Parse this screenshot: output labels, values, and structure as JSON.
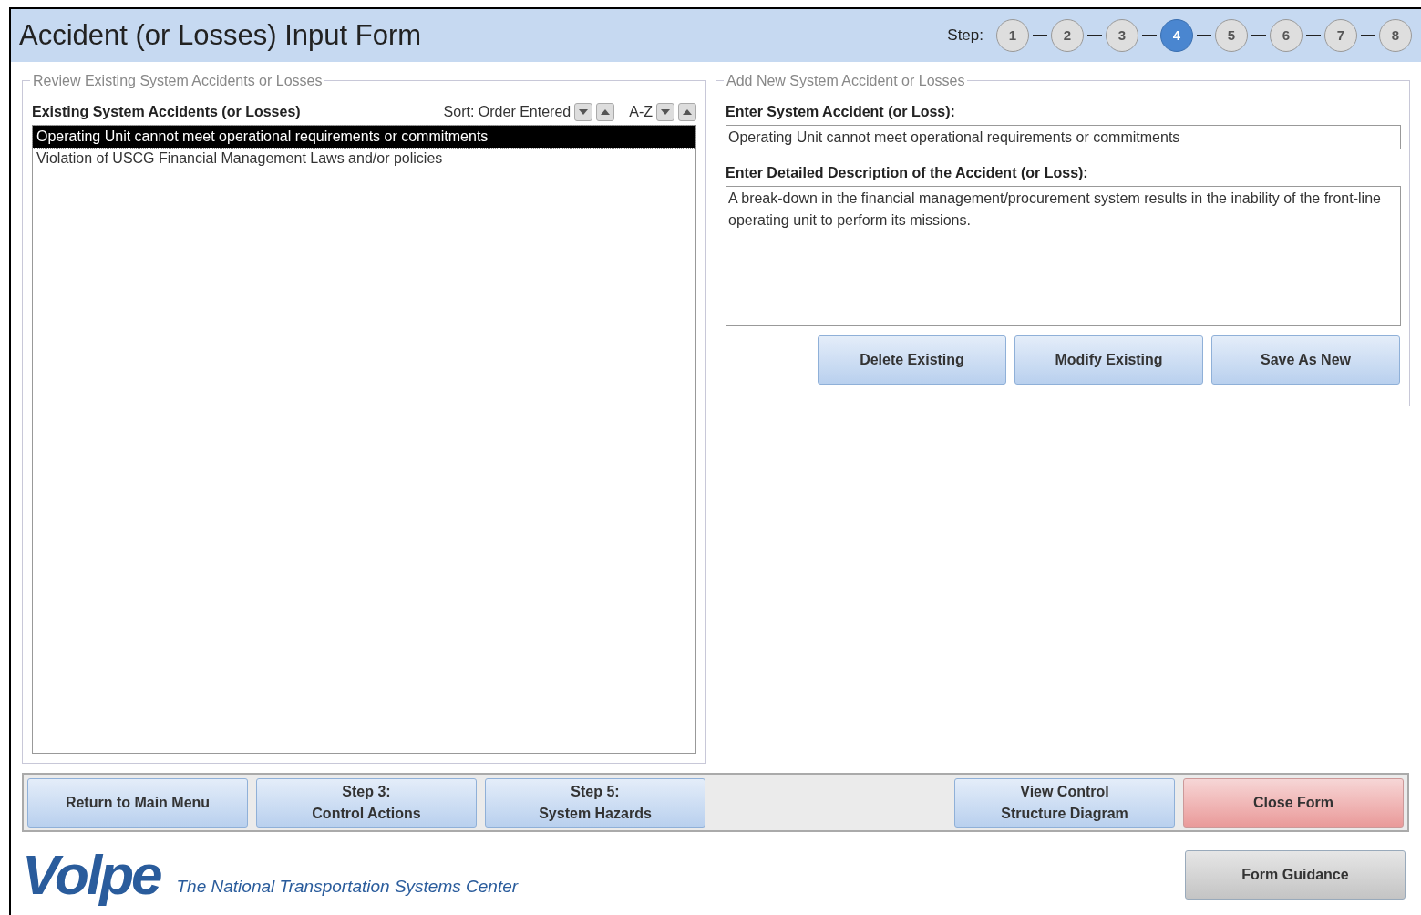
{
  "window": {
    "title": "Accident (or Losses) Input Form"
  },
  "steps": {
    "label": "Step:",
    "items": [
      {
        "label": "1",
        "selected": false
      },
      {
        "label": "2",
        "selected": false
      },
      {
        "label": "3",
        "selected": false
      },
      {
        "label": "4",
        "selected": true
      },
      {
        "label": "5",
        "selected": false
      },
      {
        "label": "6",
        "selected": false
      },
      {
        "label": "7",
        "selected": false
      },
      {
        "label": "8",
        "selected": false
      }
    ]
  },
  "review": {
    "legend": "Review Existing System Accidents or Losses",
    "list_label": "Existing System Accidents (or Losses)",
    "sort_label": "Sort: Order Entered",
    "az_label": "A-Z",
    "items": [
      {
        "text": "Operating Unit cannot meet operational requirements or commitments",
        "selected": true
      },
      {
        "text": "Violation of USCG Financial Management Laws and/or policies",
        "selected": false
      }
    ]
  },
  "add": {
    "legend": "Add New System Accident or Losses",
    "accident_label": "Enter System Accident (or Loss):",
    "accident_value": "Operating Unit cannot meet operational requirements or commitments",
    "description_label": "Enter Detailed Description of the Accident (or Loss):",
    "description_value": "A break-down in the financial management/procurement system results in the inability of the front-line operating unit to perform its missions.",
    "buttons": [
      "Delete Existing",
      "Modify Existing",
      "Save As New"
    ]
  },
  "nav_buttons": [
    {
      "lines": [
        "Return to Main Menu"
      ],
      "kind": "blue"
    },
    {
      "lines": [
        "Step 3:",
        "Control Actions"
      ],
      "kind": "blue"
    },
    {
      "lines": [
        "Step 5:",
        "System Hazards"
      ],
      "kind": "blue"
    },
    {
      "kind": "spacer"
    },
    {
      "lines": [
        "View Control",
        "Structure Diagram"
      ],
      "kind": "blue"
    },
    {
      "lines": [
        "Close Form"
      ],
      "kind": "red"
    }
  ],
  "footer": {
    "logo": "Volpe",
    "tagline": "The National Transportation Systems Center",
    "guidance_button": "Form Guidance"
  }
}
